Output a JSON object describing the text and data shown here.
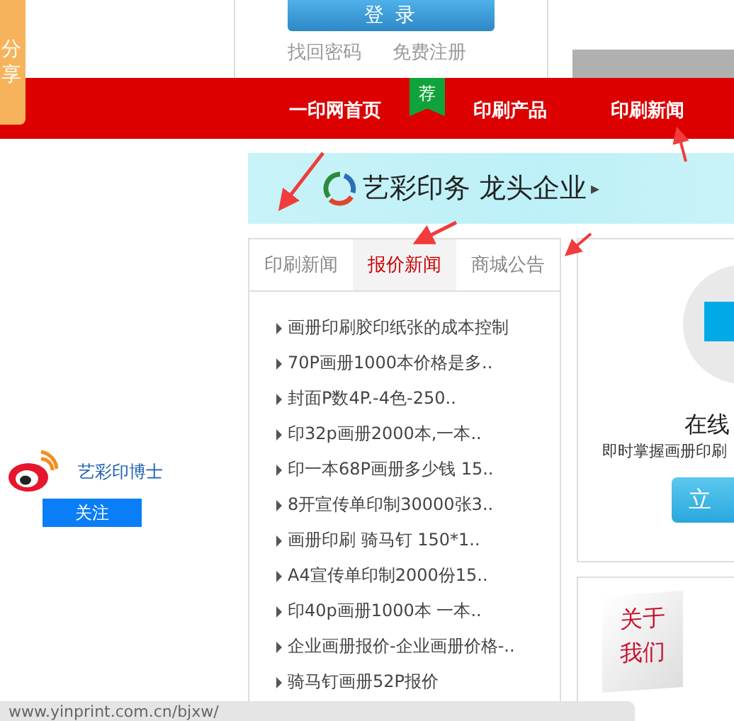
{
  "share_tab": {
    "label": "分享"
  },
  "login": {
    "button": "登 录",
    "links": [
      "找回密码",
      "免费注册"
    ]
  },
  "nav": {
    "items": [
      {
        "label": "一印网首页"
      },
      {
        "label": "印刷产品",
        "badge": "荐"
      },
      {
        "label": "印刷新闻"
      }
    ]
  },
  "banner": {
    "text": "艺彩印务 龙头企业",
    "arrow": "▸"
  },
  "news": {
    "tabs": [
      {
        "label": "印刷新闻",
        "selected": false
      },
      {
        "label": "报价新闻",
        "selected": true
      },
      {
        "label": "商城公告",
        "selected": false
      }
    ],
    "items": [
      "画册印刷胶印纸张的成本控制",
      "70P画册1000本价格是多..",
      "封面P数4P.-4色-250..",
      "印32p画册2000本,一本..",
      "印一本68P画册多少钱 15..",
      "8开宣传单印制30000张3..",
      "画册印刷 骑马钉 150*1..",
      "A4宣传单印制2000份15..",
      "印40p画册1000本 一本..",
      "企业画册报价-企业画册价格-..",
      "骑马钉画册52P报价"
    ]
  },
  "weibo": {
    "name": "艺彩印博士",
    "follow": "关注"
  },
  "service": {
    "title": "在线",
    "subtitle": "即时掌握画册印刷",
    "button": "立"
  },
  "about": {
    "label": "关于我们"
  },
  "status_bar": {
    "url": "www.yinprint.com.cn/bjxw/"
  }
}
